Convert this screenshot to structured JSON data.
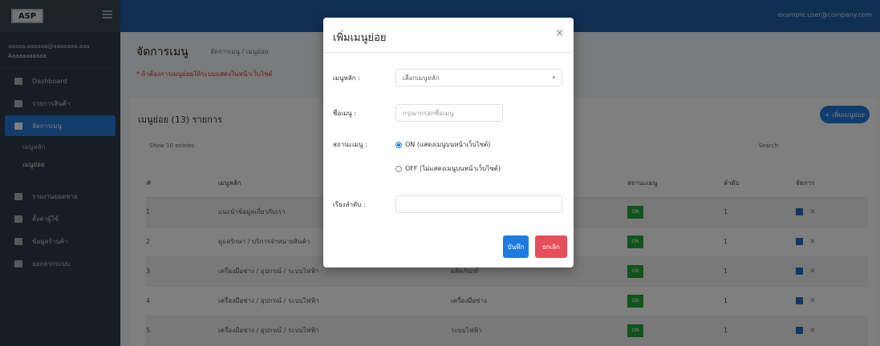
{
  "app": {
    "logo": "ASP",
    "user_link": "example.user@company.com"
  },
  "sidebar": {
    "user_line1": "aaaaa.aaaaaa@aaaaaaa.aaa",
    "user_line2": "Aaaaaaaaaaa",
    "items": [
      {
        "label": "Dashboard"
      },
      {
        "label": "รายการสินค้า"
      },
      {
        "label": "จัดการเมนู"
      },
      {
        "label": "เมนูหลัก"
      },
      {
        "label": "เมนูย่อย"
      },
      {
        "label": "รายงานยอดขาย"
      },
      {
        "label": "ตั้งค่าผู้ใช้"
      },
      {
        "label": "ข้อมูลร้านค้า"
      },
      {
        "label": "ออกจากระบบ"
      }
    ]
  },
  "page": {
    "title": "จัดการเมนู",
    "breadcrumb": "จัดการเมนู / เมนูย่อย",
    "notice": "* ถ้าต้องการเมนูย่อยให้ระบบแสดงในหน้าเว็บไซต์",
    "card_title": "เมนูย่อย (13) รายการ",
    "add_button": "+ เพิ่มเมนูย่อย",
    "show_label": "Show 10 entries",
    "search_label": "Search:",
    "columns": [
      "#",
      "เมนูหลัก",
      "",
      "สถานะเมนู",
      "ลำดับ",
      "จัดการ"
    ],
    "rows": [
      {
        "no": "1",
        "main": "แนะนำข้อมูลเกี่ยวกับเรา",
        "sub": "",
        "status": "ON",
        "order": "1"
      },
      {
        "no": "2",
        "main": "ดูแลรักษา / บริการจำหน่ายสินค้า",
        "sub": "",
        "status": "ON",
        "order": "1"
      },
      {
        "no": "3",
        "main": "เครื่องมือช่าง / อุปกรณ์ / ระบบไฟฟ้า",
        "sub": "ผลิตภัณฑ์",
        "status": "ON",
        "order": "1"
      },
      {
        "no": "4",
        "main": "เครื่องมือช่าง / อุปกรณ์ / ระบบไฟฟ้า",
        "sub": "เครื่องมือช่าง",
        "status": "ON",
        "order": "1"
      },
      {
        "no": "5",
        "main": "เครื่องมือช่าง / อุปกรณ์ / ระบบไฟฟ้า",
        "sub": "ระบบไฟฟ้า",
        "status": "ON",
        "order": "1"
      }
    ]
  },
  "modal": {
    "title": "เพิ่มเมนูย่อย",
    "close": "×",
    "main_menu_label": "เมนูหลัก :",
    "main_menu_value": "เลือกเมนูหลัก",
    "name_label": "ชื่อเมนู :",
    "name_placeholder": "กรุณากรอกชื่อเมนู",
    "status_label": "สถานะเมนู :",
    "status_on": "ON (แสดงเมนูบนหน้าเว็บไซต์)",
    "status_off": "OFF (ไม่แสดงเมนูบนหน้าเว็บไซต์)",
    "order_label": "เรียงลำดับ :",
    "order_value": "",
    "save": "บันทึก",
    "cancel": "ยกเลิก"
  }
}
